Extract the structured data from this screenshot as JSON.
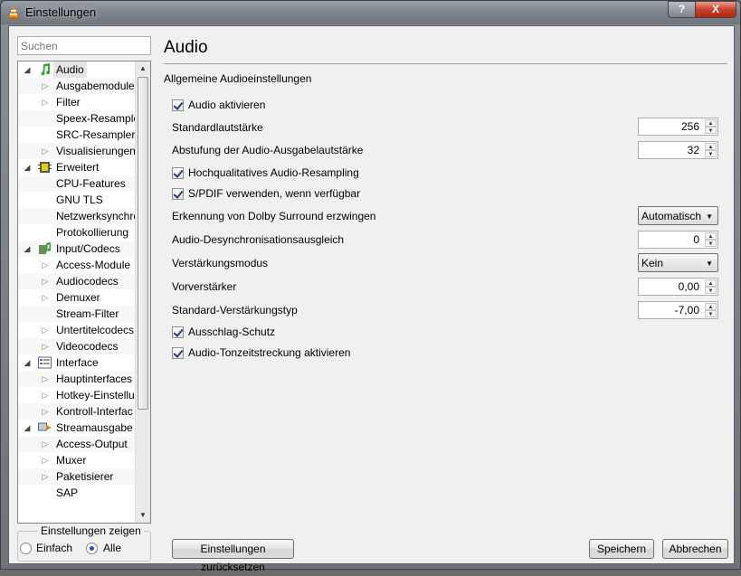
{
  "window": {
    "title": "Einstellungen",
    "help_label": "?",
    "close_label": "X"
  },
  "sidebar": {
    "search_placeholder": "Suchen",
    "items": [
      {
        "label": "Audio",
        "type": "cat",
        "icon": "music-note-icon",
        "expanded": true,
        "selected": true
      },
      {
        "label": "Ausgabemodule",
        "type": "sub",
        "has_children": true
      },
      {
        "label": "Filter",
        "type": "sub",
        "has_children": true
      },
      {
        "label": "Speex-Resampler",
        "type": "sub",
        "has_children": false
      },
      {
        "label": "SRC-Resampler",
        "type": "sub",
        "has_children": false
      },
      {
        "label": "Visualisierungen",
        "type": "sub",
        "has_children": true
      },
      {
        "label": "Erweitert",
        "type": "cat",
        "icon": "chip-icon",
        "expanded": true
      },
      {
        "label": "CPU-Features",
        "type": "sub",
        "has_children": false
      },
      {
        "label": "GNU TLS",
        "type": "sub",
        "has_children": false
      },
      {
        "label": "Netzwerksynchro",
        "type": "sub",
        "has_children": false
      },
      {
        "label": "Protokollierung",
        "type": "sub",
        "has_children": false
      },
      {
        "label": "Input/Codecs",
        "type": "cat",
        "icon": "codec-icon",
        "expanded": true
      },
      {
        "label": "Access-Module",
        "type": "sub",
        "has_children": true
      },
      {
        "label": "Audiocodecs",
        "type": "sub",
        "has_children": true
      },
      {
        "label": "Demuxer",
        "type": "sub",
        "has_children": true
      },
      {
        "label": "Stream-Filter",
        "type": "sub",
        "has_children": false
      },
      {
        "label": "Untertitelcodecs",
        "type": "sub",
        "has_children": true
      },
      {
        "label": "Videocodecs",
        "type": "sub",
        "has_children": true
      },
      {
        "label": "Interface",
        "type": "cat",
        "icon": "interface-icon",
        "expanded": true
      },
      {
        "label": "Hauptinterfaces",
        "type": "sub",
        "has_children": true
      },
      {
        "label": "Hotkey-Einstellu",
        "type": "sub",
        "has_children": true
      },
      {
        "label": "Kontroll-Interfac",
        "type": "sub",
        "has_children": true
      },
      {
        "label": "Streamausgabe",
        "type": "cat",
        "icon": "stream-output-icon",
        "expanded": true
      },
      {
        "label": "Access-Output",
        "type": "sub",
        "has_children": true
      },
      {
        "label": "Muxer",
        "type": "sub",
        "has_children": true
      },
      {
        "label": "Paketisierer",
        "type": "sub",
        "has_children": true
      },
      {
        "label": "SAP",
        "type": "sub",
        "has_children": false
      }
    ]
  },
  "show_settings": {
    "title": "Einstellungen zeigen",
    "simple_label": "Einfach",
    "all_label": "Alle",
    "selected": "Alle"
  },
  "main": {
    "title": "Audio",
    "section": "Allgemeine Audioeinstellungen",
    "enable_audio": {
      "label": "Audio aktivieren",
      "checked": true
    },
    "default_volume": {
      "label": "Standardlautstärke",
      "value": "256"
    },
    "volume_step": {
      "label": "Abstufung der Audio-Ausgabelautstärke",
      "value": "32"
    },
    "hq_resampling": {
      "label": "Hochqualitatives Audio-Resampling",
      "checked": true
    },
    "spdif": {
      "label": "S/PDIF verwenden, wenn verfügbar",
      "checked": true
    },
    "dolby": {
      "label": "Erkennung von Dolby Surround erzwingen",
      "value": "Automatisch"
    },
    "desync": {
      "label": "Audio-Desynchronisationsausgleich",
      "value": "0"
    },
    "gain_mode": {
      "label": "Verstärkungsmodus",
      "value": "Kein"
    },
    "preamp": {
      "label": "Vorverstärker",
      "value": "0,00"
    },
    "default_gain": {
      "label": "Standard-Verstärkungstyp",
      "value": "-7,00"
    },
    "spike_protection": {
      "label": "Ausschlag-Schutz",
      "checked": true
    },
    "time_stretch": {
      "label": "Audio-Tonzeitstreckung aktivieren",
      "checked": true
    }
  },
  "buttons": {
    "reset": "Einstellungen zurücksetzen",
    "save": "Speichern",
    "cancel": "Abbrechen"
  }
}
